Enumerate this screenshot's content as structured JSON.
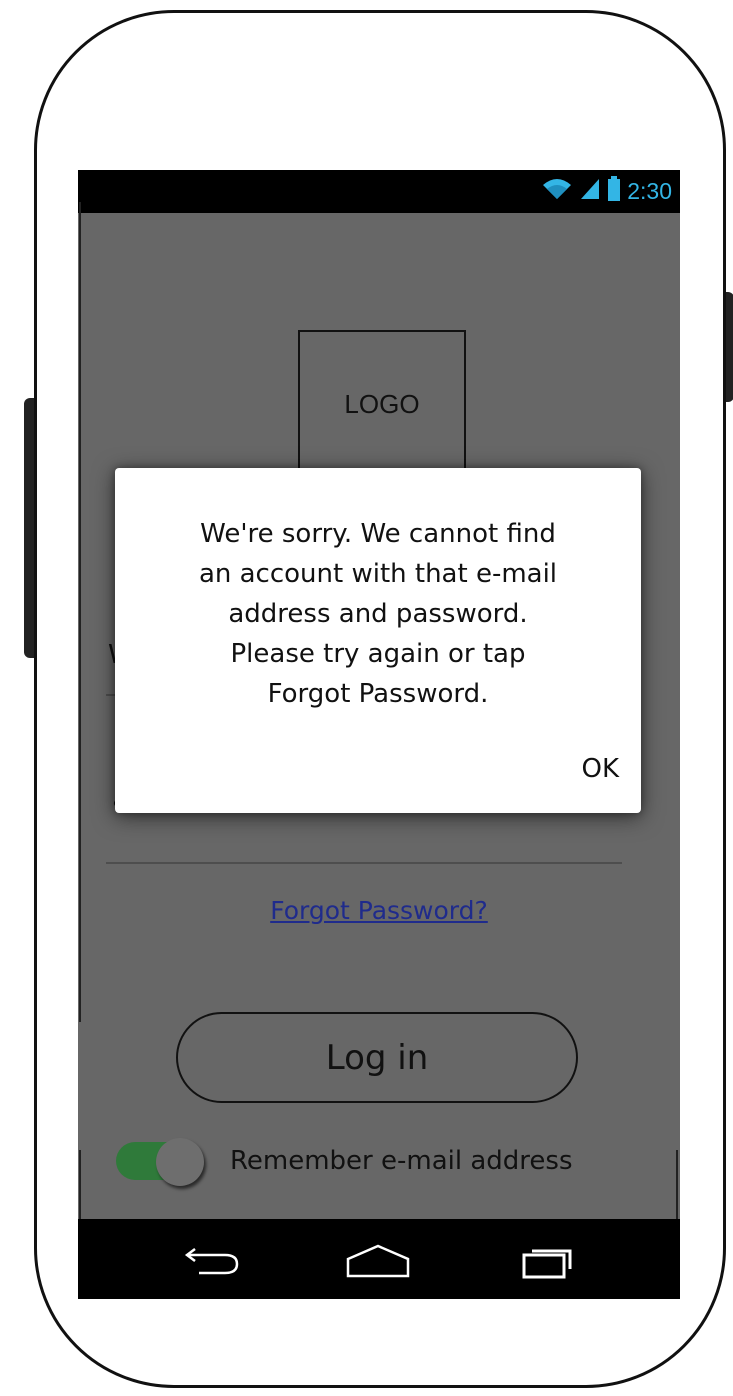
{
  "status_bar": {
    "time": "2:30",
    "icons": [
      "wifi-icon",
      "cell-signal-icon",
      "battery-icon"
    ],
    "time_color": "#33b5e5"
  },
  "logo": {
    "label": "LOGO"
  },
  "login_form": {
    "email_visible_letter": "W",
    "password_mask": "••••••••",
    "forgot_link": "Forgot Password?",
    "login_button": "Log in",
    "remember_toggle_on": true,
    "remember_label": "Remember e-mail address"
  },
  "dialog": {
    "message_lines": [
      "We're sorry. We cannot find",
      "an account with that e-mail",
      "address and password.",
      "Please try again or tap",
      "Forgot Password."
    ],
    "ok_label": "OK"
  },
  "nav_bar": {
    "buttons": [
      "back-icon",
      "home-icon",
      "recent-apps-icon"
    ]
  },
  "colors": {
    "screen_overlay": "#676767",
    "toggle_accent": "#2f7a3a",
    "link": "#1f2b8c"
  }
}
